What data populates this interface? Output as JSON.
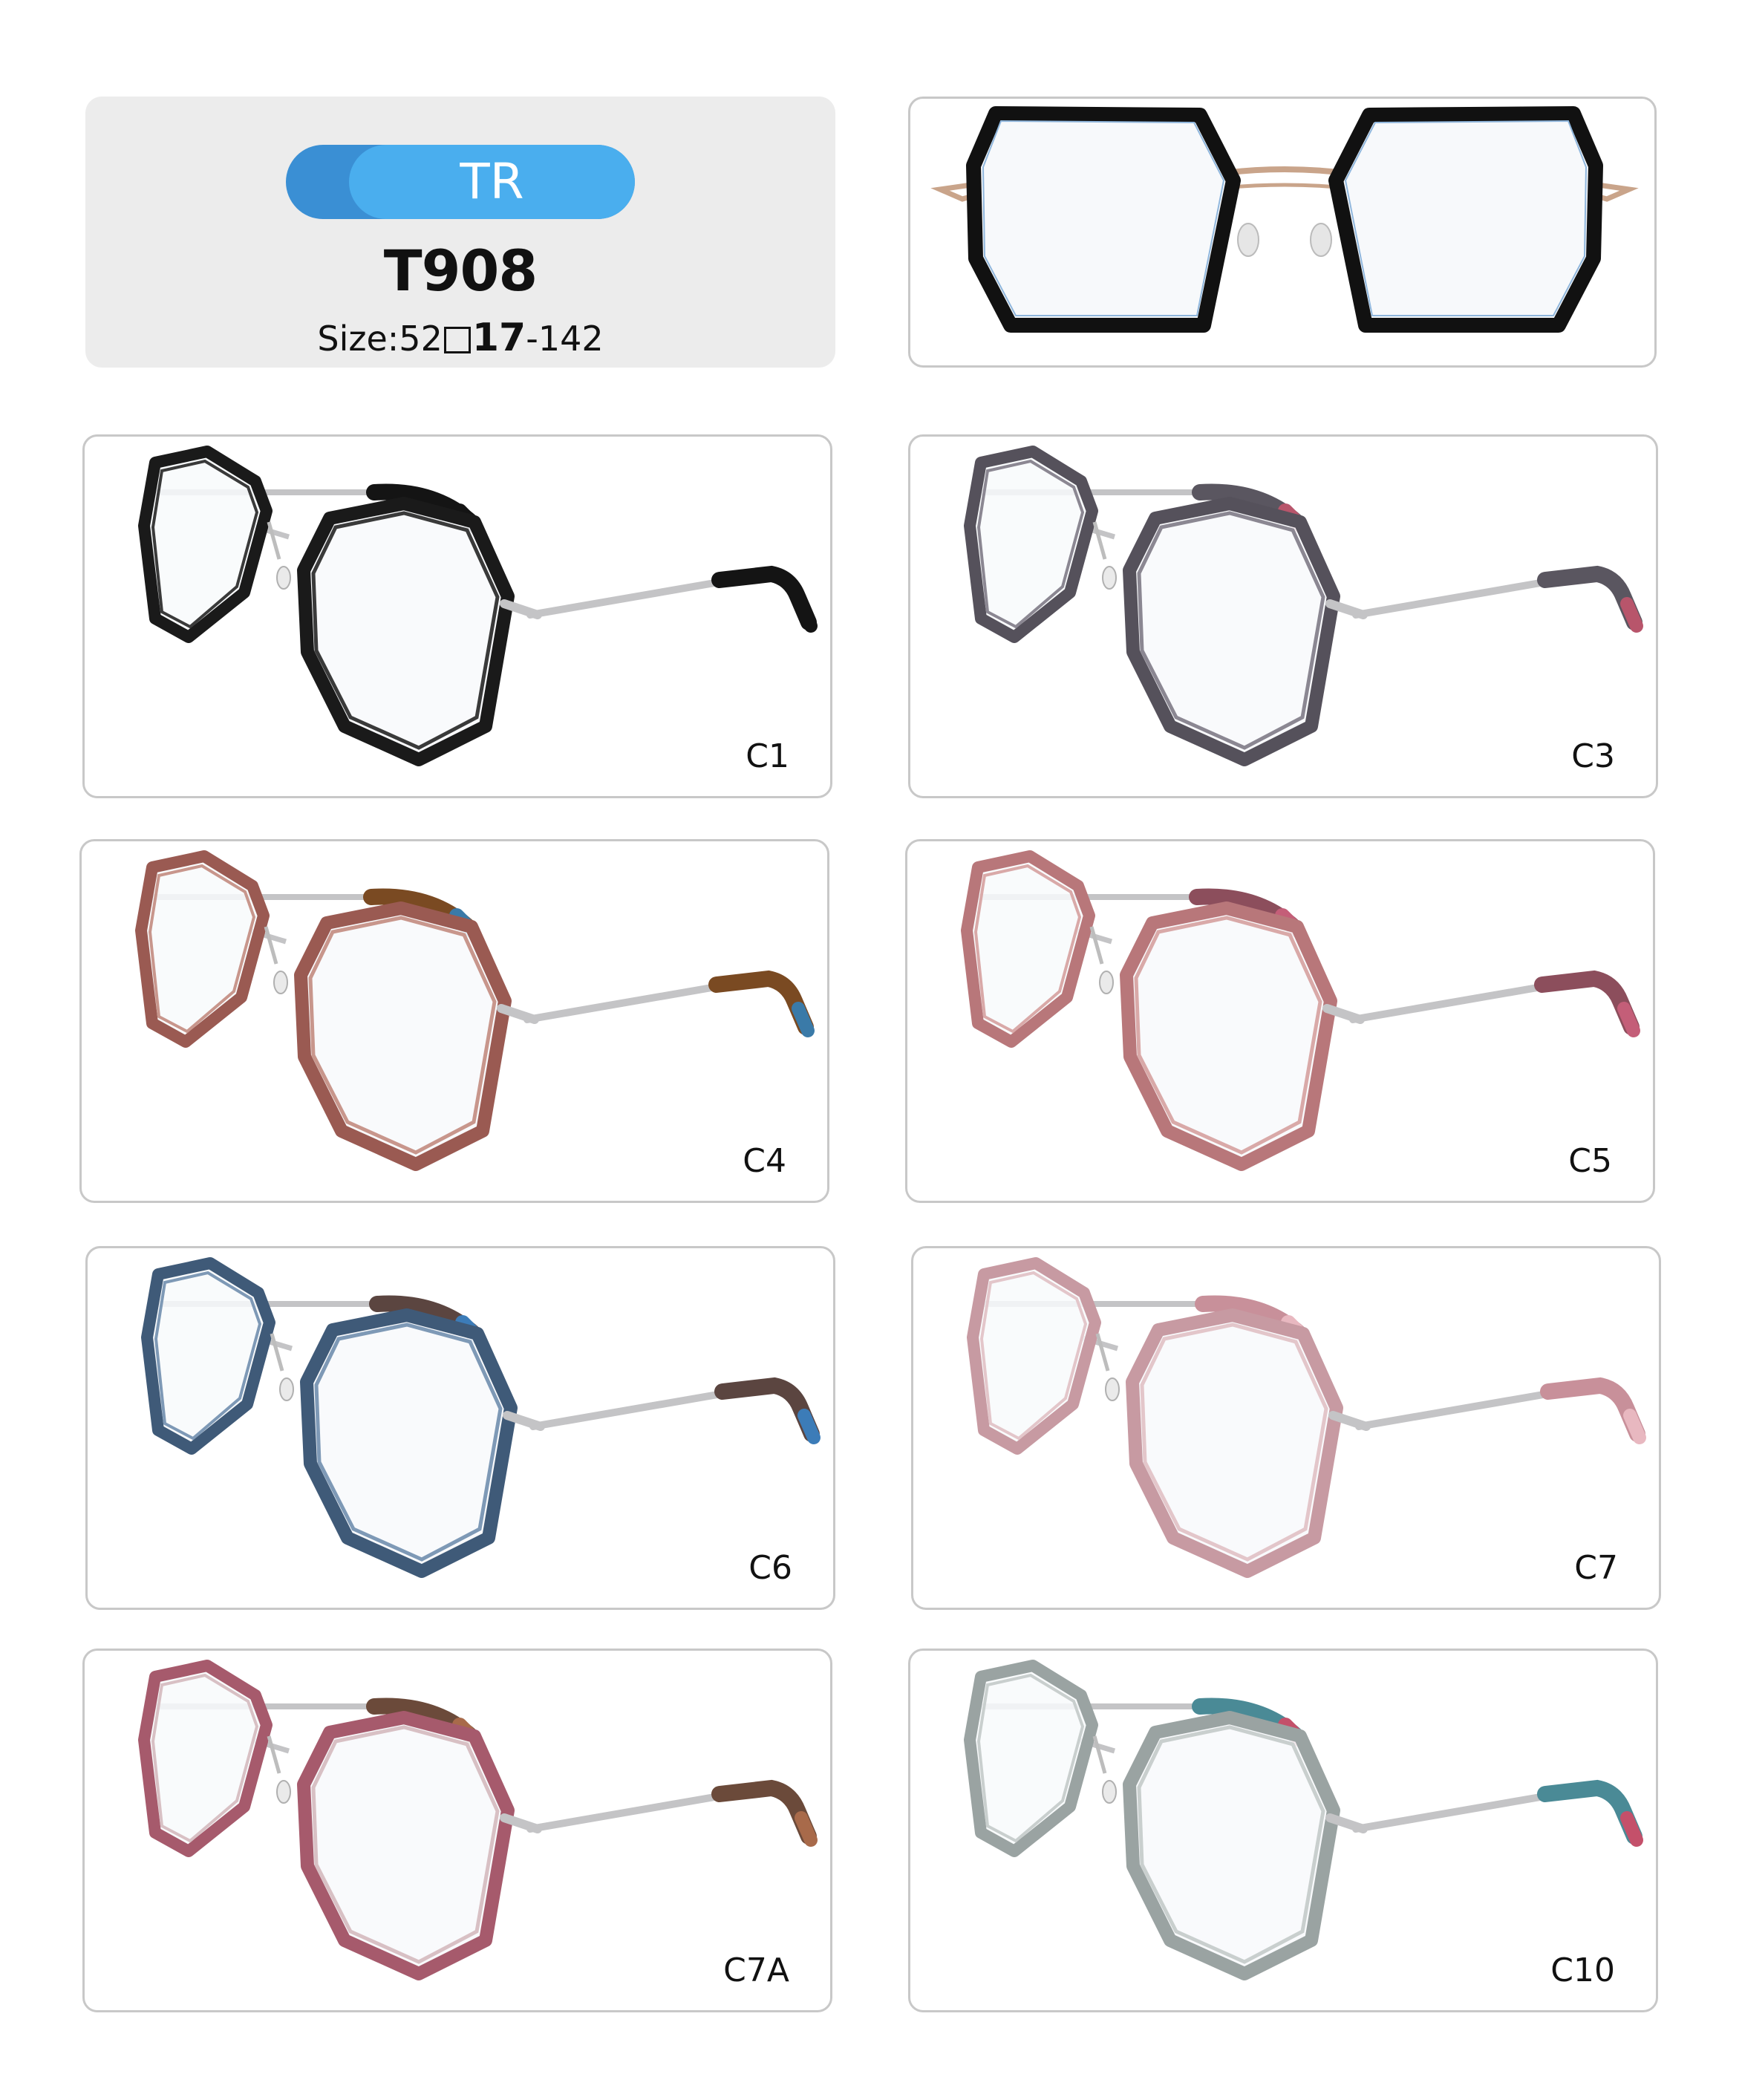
{
  "product": {
    "material": "TR",
    "model": "T908",
    "size_prefix": "Size:52",
    "size_bridge": "17",
    "size_temple": "-142"
  },
  "colorways": [
    {
      "code": "C1",
      "frame": "#1a1a1a",
      "frame_light": "#3a3a3a",
      "tip": "#141414",
      "tip_accent": "#141414"
    },
    {
      "code": "C3",
      "frame": "#55515b",
      "frame_light": "#8b8792",
      "tip": "#5a5660",
      "tip_accent": "#b8556b"
    },
    {
      "code": "C4",
      "frame": "#9a5a52",
      "frame_light": "#c8968c",
      "tip": "#7a4a22",
      "tip_accent": "#3a7aa8"
    },
    {
      "code": "C5",
      "frame": "#b8777a",
      "frame_light": "#d9a9a8",
      "tip": "#8c4e5c",
      "tip_accent": "#c45e78"
    },
    {
      "code": "C6",
      "frame": "#3f5a78",
      "frame_light": "#7e99b6",
      "tip": "#5b4540",
      "tip_accent": "#3c7cb8"
    },
    {
      "code": "C7",
      "frame": "#c79aa2",
      "frame_light": "#e3c6ca",
      "tip": "#c8909a",
      "tip_accent": "#e8b8c0"
    },
    {
      "code": "C7A",
      "frame": "#a65a6c",
      "frame_light": "#d8c0c4",
      "tip": "#6b4a3a",
      "tip_accent": "#a86a4a"
    },
    {
      "code": "C10",
      "frame": "#9aa3a2",
      "frame_light": "#c9cfce",
      "tip": "#4a8a96",
      "tip_accent": "#c4506a"
    }
  ],
  "front_view": {
    "frame": "#111111",
    "metal": "#c9a48a"
  }
}
